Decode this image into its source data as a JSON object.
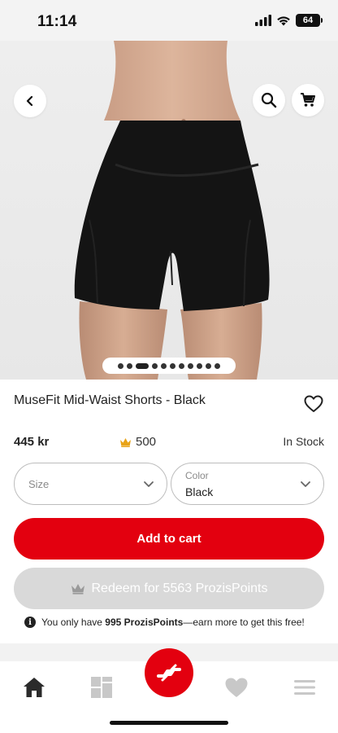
{
  "status_bar": {
    "time": "11:14",
    "battery": "64",
    "icons": [
      "signal-icon",
      "wifi-icon",
      "battery-icon"
    ]
  },
  "header": {
    "back_icon": "chevron-left-icon",
    "search_icon": "search-icon",
    "cart_icon": "shopping-cart-icon"
  },
  "gallery": {
    "image_count": 11,
    "active_index": 2
  },
  "product": {
    "title": "MuseFit Mid-Waist Shorts - Black",
    "price": "445 kr",
    "points": "500",
    "points_icon": "crown-icon",
    "stock": "In Stock",
    "wishlist_icon": "heart-outline-icon"
  },
  "options": {
    "size_placeholder": "Size",
    "color_label": "Color",
    "color_value": "Black"
  },
  "actions": {
    "add_to_cart": "Add to cart",
    "redeem": "Redeem for 5563 ProzisPoints"
  },
  "note": {
    "prefix": "You only have ",
    "points_amount": "995 ProzisPoints",
    "suffix": "—earn more to get this free!"
  },
  "bottom_nav": {
    "items": [
      "home-icon",
      "categories-icon",
      "prozis-logo-icon",
      "heart-icon",
      "menu-icon"
    ]
  },
  "colors": {
    "accent": "#e3000f",
    "disabled": "#d9d9d9",
    "crown": "#e8a317"
  }
}
